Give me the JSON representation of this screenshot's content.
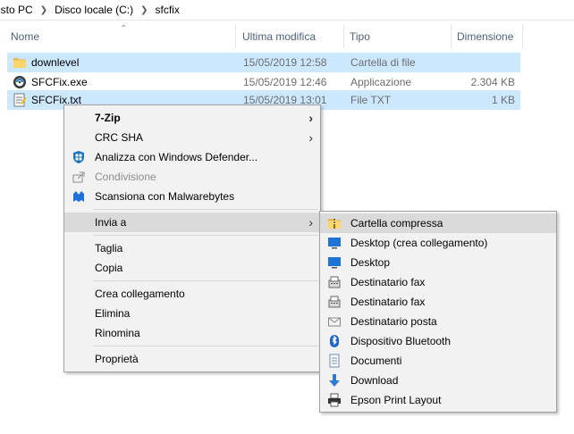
{
  "breadcrumb": {
    "items": [
      "esto PC",
      "Disco locale (C:)",
      "sfcfix"
    ]
  },
  "columns": {
    "name": "Nome",
    "modified": "Ultima modifica",
    "type": "Tipo",
    "size": "Dimensione"
  },
  "files": [
    {
      "name": "downlevel",
      "modified": "15/05/2019 12:58",
      "type": "Cartella di file",
      "size": "",
      "icon": "folder-icon"
    },
    {
      "name": "SFCFix.exe",
      "modified": "15/05/2019 12:46",
      "type": "Applicazione",
      "size": "2.304 KB",
      "icon": "exe-icon"
    },
    {
      "name": "SFCFix.txt",
      "modified": "15/05/2019 13:01",
      "type": "File TXT",
      "size": "1 KB",
      "icon": "text-file-icon"
    }
  ],
  "context_menu": {
    "items": [
      {
        "label": "7-Zip"
      },
      {
        "label": "CRC SHA"
      },
      {
        "label": "Analizza con Windows Defender..."
      },
      {
        "label": "Condivisione"
      },
      {
        "label": "Scansiona con Malwarebytes"
      },
      {
        "label": "Invia a"
      },
      {
        "label": "Taglia"
      },
      {
        "label": "Copia"
      },
      {
        "label": "Crea collegamento"
      },
      {
        "label": "Elimina"
      },
      {
        "label": "Rinomina"
      },
      {
        "label": "Proprietà"
      }
    ]
  },
  "send_to_menu": {
    "items": [
      {
        "label": "Cartella compressa",
        "icon": "zip-folder-icon"
      },
      {
        "label": "Desktop (crea collegamento)",
        "icon": "desktop-icon"
      },
      {
        "label": "Desktop",
        "icon": "desktop-icon"
      },
      {
        "label": "Destinatario fax",
        "icon": "fax-icon"
      },
      {
        "label": "Destinatario fax",
        "icon": "fax-icon"
      },
      {
        "label": "Destinatario posta",
        "icon": "mail-icon"
      },
      {
        "label": "Dispositivo Bluetooth",
        "icon": "bluetooth-icon"
      },
      {
        "label": "Documenti",
        "icon": "documents-icon"
      },
      {
        "label": "Download",
        "icon": "download-icon"
      },
      {
        "label": "Epson Print Layout",
        "icon": "printer-icon"
      }
    ]
  },
  "colors": {
    "selection": "#cce8ff",
    "menu_bg": "#f2f2f2",
    "menu_highlight": "#dadada",
    "header_text": "#4c607a"
  }
}
